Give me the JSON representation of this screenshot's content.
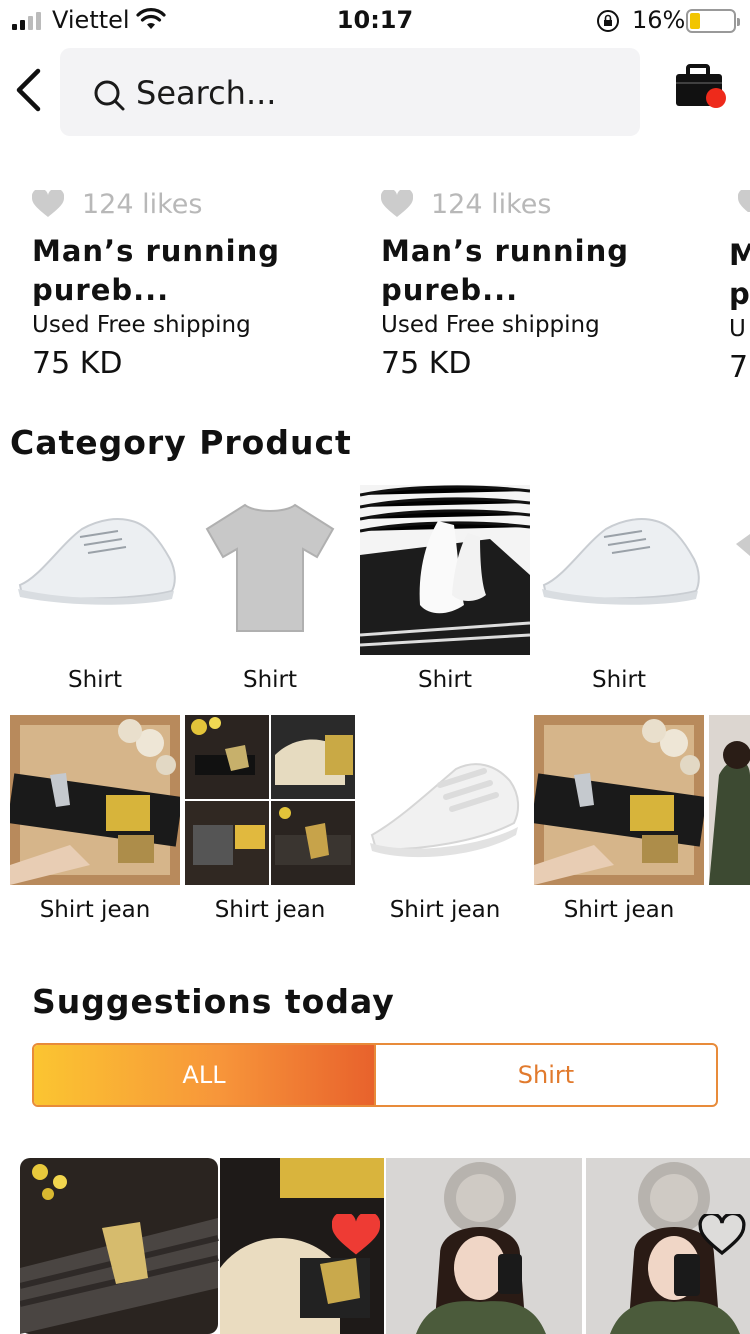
{
  "status_bar": {
    "carrier": "Viettel",
    "time": "10:17",
    "battery": "16%",
    "battery_level": 0.16
  },
  "header": {
    "search_placeholder": "Search..."
  },
  "liked_products": [
    {
      "likes": "124 likes",
      "name_line1": "Man’s running",
      "name_line2": "pureb...",
      "shipping": "Used Free shipping",
      "price": "75 KD"
    },
    {
      "likes": "124 likes",
      "name_line1": "Man’s running",
      "name_line2": "pureb...",
      "shipping": "Used Free shipping",
      "price": "75 KD"
    }
  ],
  "category_section": {
    "title": "Category Product",
    "row1": [
      {
        "label": "Shirt"
      },
      {
        "label": "Shirt"
      },
      {
        "label": "Shirt"
      },
      {
        "label": "Shirt"
      }
    ],
    "row2": [
      {
        "label": "Shirt jean"
      },
      {
        "label": "Shirt jean"
      },
      {
        "label": "Shirt jean"
      },
      {
        "label": "Shirt jean"
      }
    ]
  },
  "suggestions": {
    "title": "Suggestions today",
    "tabs": [
      {
        "label": "ALL",
        "active": true
      },
      {
        "label": "Shirt",
        "active": false
      }
    ]
  },
  "colors": {
    "accent": "#e88b3a",
    "gradient_start": "#fbc531",
    "gradient_end": "#e8622c",
    "heart_liked": "#ee3b34",
    "cart_badge": "#ee2a1b"
  }
}
